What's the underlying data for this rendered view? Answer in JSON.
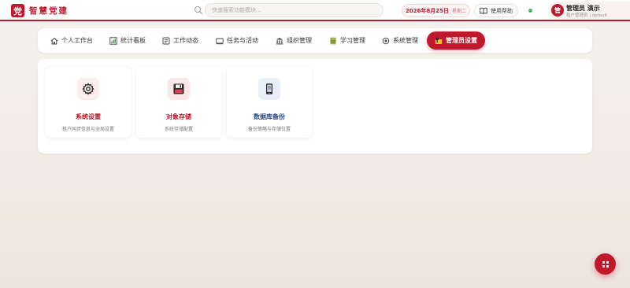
{
  "header": {
    "logo_char": "党",
    "app_title": "智慧党建",
    "search_placeholder": "快速搜索功能模块...",
    "date": "2026年8月25日",
    "weekday": "星期二",
    "help_label": "使用帮助",
    "user": {
      "avatar_char": "管",
      "name": "管理员 演示",
      "role": "租户管理员 | default"
    }
  },
  "nav": {
    "items": [
      {
        "label": "个人工作台",
        "icon": "home-icon"
      },
      {
        "label": "统计看板",
        "icon": "chart-icon"
      },
      {
        "label": "工作动态",
        "icon": "news-icon"
      },
      {
        "label": "任务与活动",
        "icon": "task-icon"
      },
      {
        "label": "组织管理",
        "icon": "building-icon"
      },
      {
        "label": "学习管理",
        "icon": "book-icon"
      },
      {
        "label": "系统管理",
        "icon": "settings-icon"
      }
    ],
    "active": {
      "label": "管理员设置",
      "icon": "admin-key-icon"
    }
  },
  "cards": [
    {
      "title": "系统设置",
      "desc": "租户同步信息与全局设置",
      "icon": "gear-icon",
      "title_color": "#b8182c",
      "icon_bg": "#fbecee"
    },
    {
      "title": "对象存储",
      "desc": "系统存储配置",
      "icon": "floppy-icon",
      "title_color": "#b8182c",
      "icon_bg": "#fbe6ea"
    },
    {
      "title": "数据库备份",
      "desc": "备份策略与存储位置",
      "icon": "database-icon",
      "title_color": "#2b4c8c",
      "icon_bg": "#e9eff8"
    }
  ],
  "colors": {
    "brand": "#c0182c",
    "online": "#3fbf5a"
  }
}
